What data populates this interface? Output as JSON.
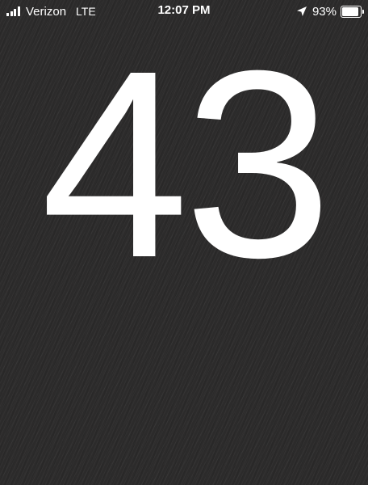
{
  "status_bar": {
    "carrier": "Verizon",
    "network": "LTE",
    "time": "12:07 PM",
    "battery_percent": "93%",
    "battery_level": 0.93,
    "location_icon": "location-arrow-icon",
    "signal_icon": "signal-bars-icon",
    "battery_icon": "battery-icon"
  },
  "display": {
    "number": "43"
  },
  "colors": {
    "background": "#2c2b2b",
    "text": "#ffffff"
  }
}
